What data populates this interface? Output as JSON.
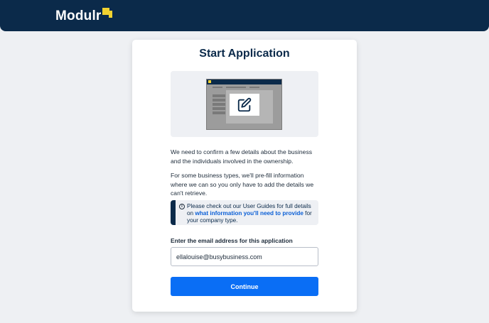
{
  "brand": {
    "name": "Modulr",
    "colors": {
      "navy": "#0b2a4a",
      "accent": "#f2d230",
      "primary": "#0a6ef5"
    }
  },
  "page": {
    "title": "Start Application",
    "intro_1": "We need to confirm a few details about the business and the individuals involved in the ownership.",
    "intro_2": "For some business types, we'll pre-fill information where we can so you only have to add the details we can't retrieve."
  },
  "info_box": {
    "icon": "info-icon",
    "text_before": "Please check out our User Guides for full details on ",
    "link_text": "what information you'll need to provide",
    "text_after": " for your company type."
  },
  "email": {
    "label": "Enter the email address for this application",
    "value": "ellalouise@busybusiness.com"
  },
  "actions": {
    "continue_label": "Continue"
  },
  "illustration": {
    "icon": "edit-icon"
  }
}
